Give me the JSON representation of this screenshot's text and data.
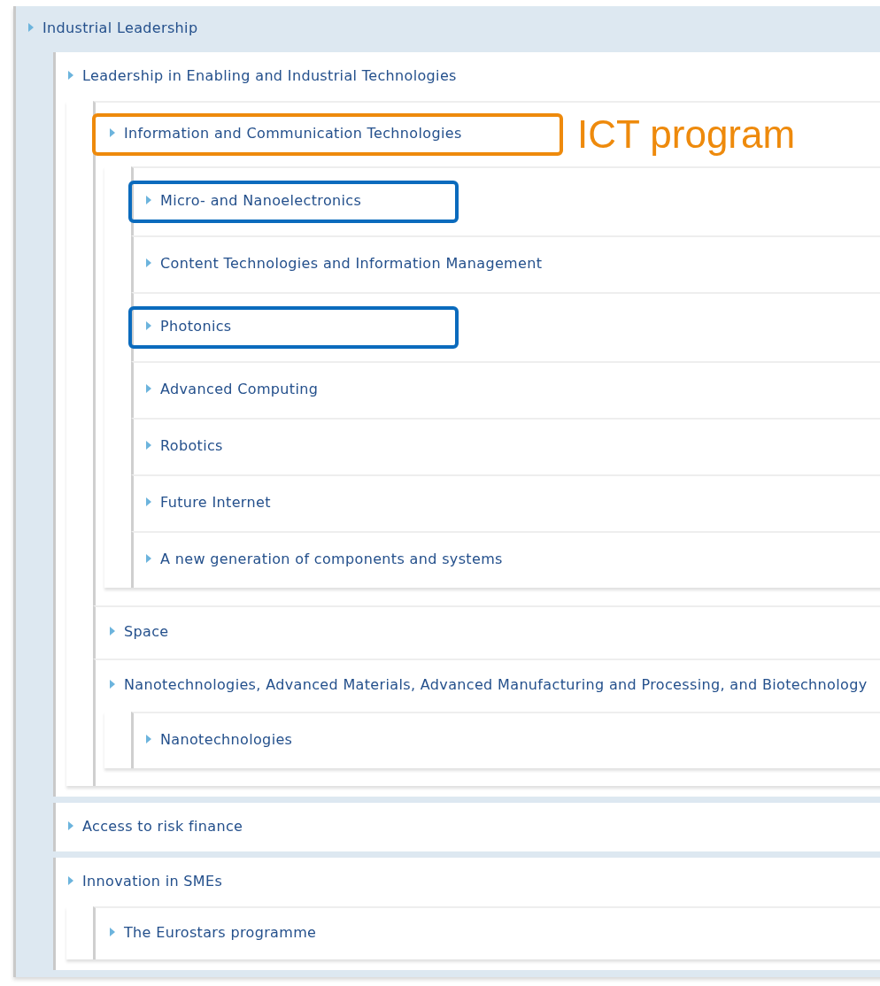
{
  "tree": {
    "label": "Industrial Leadership",
    "children": [
      {
        "label": "Leadership in Enabling and Industrial Technologies",
        "children": [
          {
            "label": "Information and Communication Technologies",
            "color": "#ee8a0c",
            "annotation": "ICT program",
            "children": [
              {
                "label": "Micro- and Nanoelectronics",
                "color": "#0b6bbd"
              },
              {
                "label": "Content Technologies and Information Management"
              },
              {
                "label": "Photonics",
                "color": "#0b6bbd"
              },
              {
                "label": "Advanced Computing"
              },
              {
                "label": "Robotics"
              },
              {
                "label": "Future Internet"
              },
              {
                "label": "A new generation of components and systems"
              }
            ]
          },
          {
            "label": "Space"
          },
          {
            "label": "Nanotechnologies, Advanced Materials, Advanced Manufacturing and Processing, and Biotechnology",
            "children": [
              {
                "label": "Nanotechnologies"
              }
            ]
          }
        ]
      },
      {
        "label": "Access to risk finance"
      },
      {
        "label": "Innovation in SMEs",
        "children": [
          {
            "label": "The Eurostars programme"
          }
        ]
      }
    ]
  }
}
